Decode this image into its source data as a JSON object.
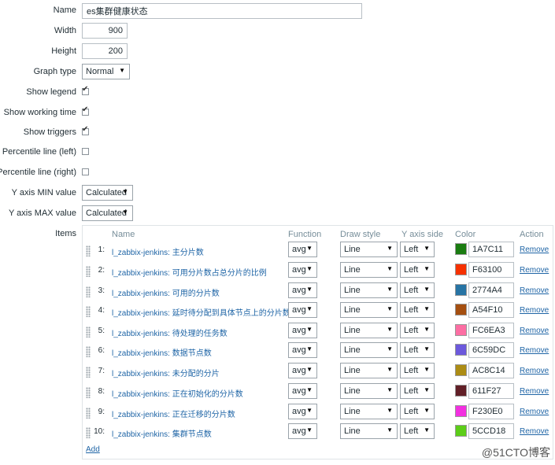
{
  "form": {
    "name_label": "Name",
    "name_value": "es集群健康状态",
    "width_label": "Width",
    "width_value": "900",
    "height_label": "Height",
    "height_value": "200",
    "graph_type_label": "Graph type",
    "graph_type_value": "Normal",
    "show_legend_label": "Show legend",
    "show_legend_checked": true,
    "show_working_time_label": "Show working time",
    "show_working_time_checked": true,
    "show_triggers_label": "Show triggers",
    "show_triggers_checked": true,
    "percentile_left_label": "Percentile line (left)",
    "percentile_left_checked": false,
    "percentile_right_label": "Percentile line (right)",
    "percentile_right_checked": false,
    "ymin_label": "Y axis MIN value",
    "ymin_value": "Calculated",
    "ymax_label": "Y axis MAX value",
    "ymax_value": "Calculated",
    "items_label": "Items"
  },
  "items_table": {
    "headers": {
      "name": "Name",
      "function": "Function",
      "draw_style": "Draw style",
      "y_axis_side": "Y axis side",
      "color": "Color",
      "action": "Action"
    },
    "rows": [
      {
        "index": "1:",
        "name": "l_zabbix-jenkins: 主分片数",
        "function": "avg",
        "draw_style": "Line",
        "y_axis_side": "Left",
        "color": "1A7C11",
        "remove": "Remove"
      },
      {
        "index": "2:",
        "name": "l_zabbix-jenkins: 可用分片数占总分片的比例",
        "function": "avg",
        "draw_style": "Line",
        "y_axis_side": "Left",
        "color": "F63100",
        "remove": "Remove"
      },
      {
        "index": "3:",
        "name": "l_zabbix-jenkins: 可用的分片数",
        "function": "avg",
        "draw_style": "Line",
        "y_axis_side": "Left",
        "color": "2774A4",
        "remove": "Remove"
      },
      {
        "index": "4:",
        "name": "l_zabbix-jenkins: 延时待分配到具体节点上的分片数",
        "function": "avg",
        "draw_style": "Line",
        "y_axis_side": "Left",
        "color": "A54F10",
        "remove": "Remove"
      },
      {
        "index": "5:",
        "name": "l_zabbix-jenkins: 待处理的任务数",
        "function": "avg",
        "draw_style": "Line",
        "y_axis_side": "Left",
        "color": "FC6EA3",
        "remove": "Remove"
      },
      {
        "index": "6:",
        "name": "l_zabbix-jenkins: 数据节点数",
        "function": "avg",
        "draw_style": "Line",
        "y_axis_side": "Left",
        "color": "6C59DC",
        "remove": "Remove"
      },
      {
        "index": "7:",
        "name": "l_zabbix-jenkins: 未分配的分片",
        "function": "avg",
        "draw_style": "Line",
        "y_axis_side": "Left",
        "color": "AC8C14",
        "remove": "Remove"
      },
      {
        "index": "8:",
        "name": "l_zabbix-jenkins: 正在初始化的分片数",
        "function": "avg",
        "draw_style": "Line",
        "y_axis_side": "Left",
        "color": "611F27",
        "remove": "Remove"
      },
      {
        "index": "9:",
        "name": "l_zabbix-jenkins: 正在迁移的分片数",
        "function": "avg",
        "draw_style": "Line",
        "y_axis_side": "Left",
        "color": "F230E0",
        "remove": "Remove"
      },
      {
        "index": "10:",
        "name": "l_zabbix-jenkins: 集群节点数",
        "function": "avg",
        "draw_style": "Line",
        "y_axis_side": "Left",
        "color": "5CCD18",
        "remove": "Remove"
      }
    ],
    "add_label": "Add"
  },
  "watermark": "@51CTO博客"
}
